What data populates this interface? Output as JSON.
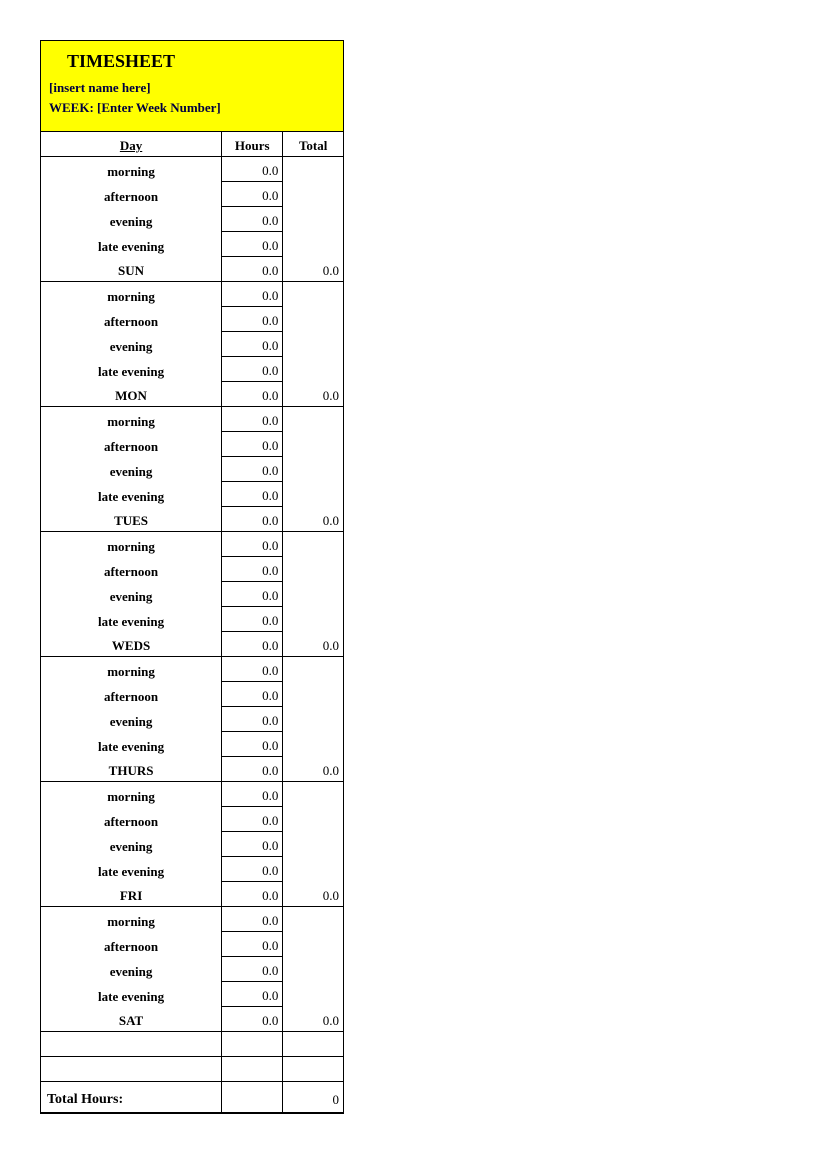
{
  "header": {
    "title": "TIMESHEET",
    "name_placeholder": "[insert  name here]",
    "week_label": "WEEK: [Enter Week Number]"
  },
  "columns": {
    "day": "Day",
    "hours": "Hours",
    "total": "Total"
  },
  "slots": [
    "morning",
    "afternoon",
    "evening",
    "late evening"
  ],
  "days": [
    {
      "name": "SUN",
      "hours": [
        "0.0",
        "0.0",
        "0.0",
        "0.0"
      ],
      "sum": "0.0",
      "total": "0.0"
    },
    {
      "name": "MON",
      "hours": [
        "0.0",
        "0.0",
        "0.0",
        "0.0"
      ],
      "sum": "0.0",
      "total": "0.0"
    },
    {
      "name": "TUES",
      "hours": [
        "0.0",
        "0.0",
        "0.0",
        "0.0"
      ],
      "sum": "0.0",
      "total": "0.0"
    },
    {
      "name": "WEDS",
      "hours": [
        "0.0",
        "0.0",
        "0.0",
        "0.0"
      ],
      "sum": "0.0",
      "total": "0.0"
    },
    {
      "name": "THURS",
      "hours": [
        "0.0",
        "0.0",
        "0.0",
        "0.0"
      ],
      "sum": "0.0",
      "total": "0.0"
    },
    {
      "name": "FRI",
      "hours": [
        "0.0",
        "0.0",
        "0.0",
        "0.0"
      ],
      "sum": "0.0",
      "total": "0.0"
    },
    {
      "name": "SAT",
      "hours": [
        "0.0",
        "0.0",
        "0.0",
        "0.0"
      ],
      "sum": "0.0",
      "total": "0.0"
    }
  ],
  "grand": {
    "label": "Total Hours:",
    "value": "0"
  }
}
